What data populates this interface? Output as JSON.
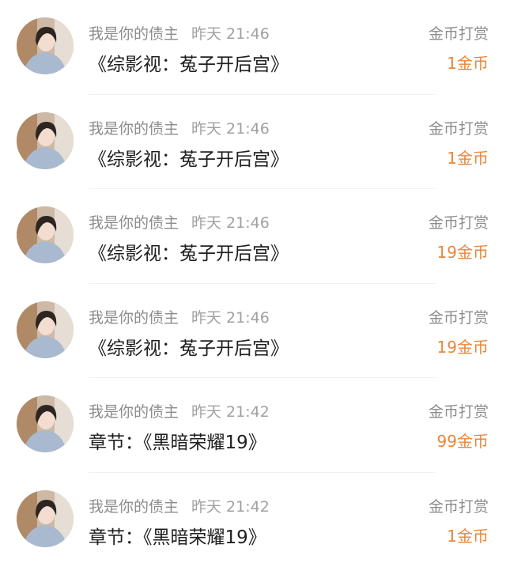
{
  "items": [
    {
      "user": "我是你的债主",
      "time": "昨天 21:46",
      "title": "《综影视：菟子开后宫》",
      "kind": "金币打赏",
      "amount": "1金币"
    },
    {
      "user": "我是你的债主",
      "time": "昨天 21:46",
      "title": "《综影视：菟子开后宫》",
      "kind": "金币打赏",
      "amount": "1金币"
    },
    {
      "user": "我是你的债主",
      "time": "昨天 21:46",
      "title": "《综影视：菟子开后宫》",
      "kind": "金币打赏",
      "amount": "19金币"
    },
    {
      "user": "我是你的债主",
      "time": "昨天 21:46",
      "title": "《综影视：菟子开后宫》",
      "kind": "金币打赏",
      "amount": "19金币"
    },
    {
      "user": "我是你的债主",
      "time": "昨天 21:42",
      "title": "章节：《黑暗荣耀19》",
      "kind": "金币打赏",
      "amount": "99金币"
    },
    {
      "user": "我是你的债主",
      "time": "昨天 21:42",
      "title": "章节：《黑暗荣耀19》",
      "kind": "金币打赏",
      "amount": "1金币"
    }
  ],
  "colors": {
    "amount": "#e8863a",
    "meta": "#8c8c8c",
    "title": "#1e1e1e"
  },
  "icons": {
    "avatar": "user-avatar-photo"
  }
}
